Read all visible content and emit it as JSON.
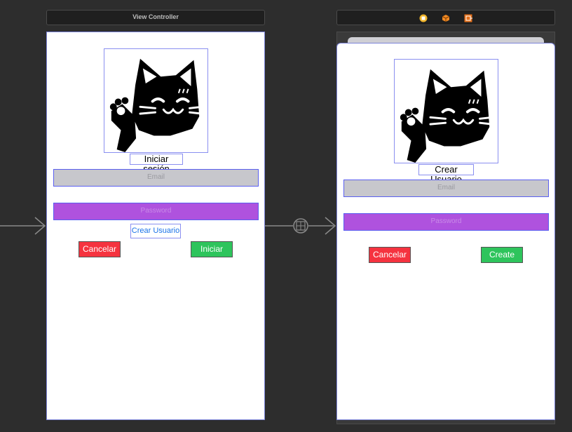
{
  "canvas": {
    "background": "#2d2d2d"
  },
  "scene_left": {
    "title": "View Controller",
    "header_label": "Iniciar sesión",
    "email_placeholder": "Email",
    "password_placeholder": "Password",
    "create_link": "Crear Usuario",
    "cancel_label": "Cancelar",
    "primary_label": "Iniciar"
  },
  "scene_right": {
    "dock_icons": [
      "view-controller-icon",
      "first-responder-icon",
      "exit-icon"
    ],
    "header_label": "Crear Usuario",
    "email_placeholder": "Email",
    "password_placeholder": "Password",
    "cancel_label": "Cancelar",
    "primary_label": "Create"
  },
  "colors": {
    "email_field": "#c7c7cc",
    "password_field": "#af52de",
    "cancel_button": "#f5333f",
    "primary_button": "#2ec45c",
    "selection_border": "#7b83d8"
  }
}
